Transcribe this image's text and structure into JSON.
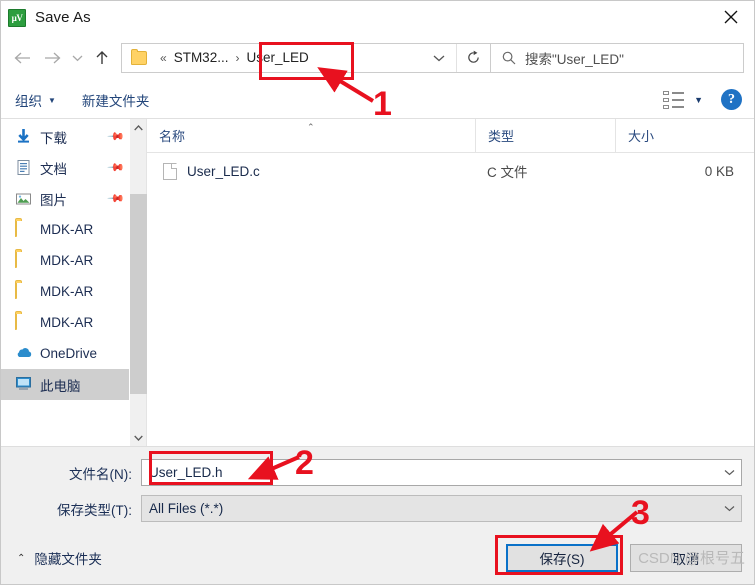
{
  "window": {
    "title": "Save As",
    "app_icon": "uvision-icon",
    "close_label": "✕"
  },
  "nav": {
    "back_icon": "arrow-left-icon",
    "forward_icon": "arrow-right-icon",
    "history_icon": "chevron-down-icon",
    "up_icon": "arrow-up-icon",
    "breadcrumb": {
      "folder_icon": "folder-icon",
      "overflow": "«",
      "parent": "STM32...",
      "separator": "›",
      "current": "User_LED"
    },
    "dropdown_icon": "chevron-down-icon",
    "refresh_icon": "refresh-icon"
  },
  "search": {
    "icon": "search-icon",
    "placeholder": "搜索\"User_LED\""
  },
  "commandbar": {
    "organize": "组织",
    "organize_caret": "▼",
    "new_folder": "新建文件夹",
    "view_icon": "view-options-icon",
    "view_caret": "▼",
    "help_icon": "help-icon",
    "help_label": "?"
  },
  "sidebar": {
    "items": [
      {
        "label": "下载",
        "icon": "download-icon",
        "pinned": true,
        "selected": false
      },
      {
        "label": "文档",
        "icon": "document-icon",
        "pinned": true,
        "selected": false
      },
      {
        "label": "图片",
        "icon": "pictures-icon",
        "pinned": true,
        "selected": false
      },
      {
        "label": "MDK-AR",
        "icon": "folder-icon",
        "pinned": false,
        "selected": false
      },
      {
        "label": "MDK-AR",
        "icon": "folder-icon",
        "pinned": false,
        "selected": false
      },
      {
        "label": "MDK-AR",
        "icon": "folder-icon",
        "pinned": false,
        "selected": false
      },
      {
        "label": "MDK-AR",
        "icon": "folder-icon",
        "pinned": false,
        "selected": false
      },
      {
        "label": "OneDrive",
        "icon": "onedrive-icon",
        "pinned": false,
        "selected": false
      },
      {
        "label": "此电脑",
        "icon": "this-pc-icon",
        "pinned": false,
        "selected": true
      }
    ],
    "scroll_up_icon": "chevron-up-icon",
    "scroll_down_icon": "chevron-down-icon"
  },
  "filelist": {
    "columns": [
      {
        "label": "名称",
        "sorted": true,
        "sort_caret": "⌃"
      },
      {
        "label": "类型",
        "sorted": false,
        "sort_caret": ""
      },
      {
        "label": "大小",
        "sorted": false,
        "sort_caret": ""
      }
    ],
    "rows": [
      {
        "name": "User_LED.c",
        "icon": "file-icon",
        "type": "C 文件",
        "size": "0 KB"
      }
    ]
  },
  "form": {
    "filename_label": "文件名(N):",
    "filename_value": "User_LED.h",
    "filetype_label": "保存类型(T):",
    "filetype_value": "All Files (*.*)",
    "combo_arrow": "⌄"
  },
  "footer": {
    "hide_folders_caret": "⌃",
    "hide_folders": "隐藏文件夹",
    "save_button": "保存(S)",
    "cancel_button": "取消"
  },
  "annotations": {
    "accent_color": "#e8111f",
    "markers": [
      {
        "number": "1",
        "target": "breadcrumb-current"
      },
      {
        "number": "2",
        "target": "filename-input"
      },
      {
        "number": "3",
        "target": "save-button"
      }
    ]
  },
  "watermark": "CSDN @根号五"
}
